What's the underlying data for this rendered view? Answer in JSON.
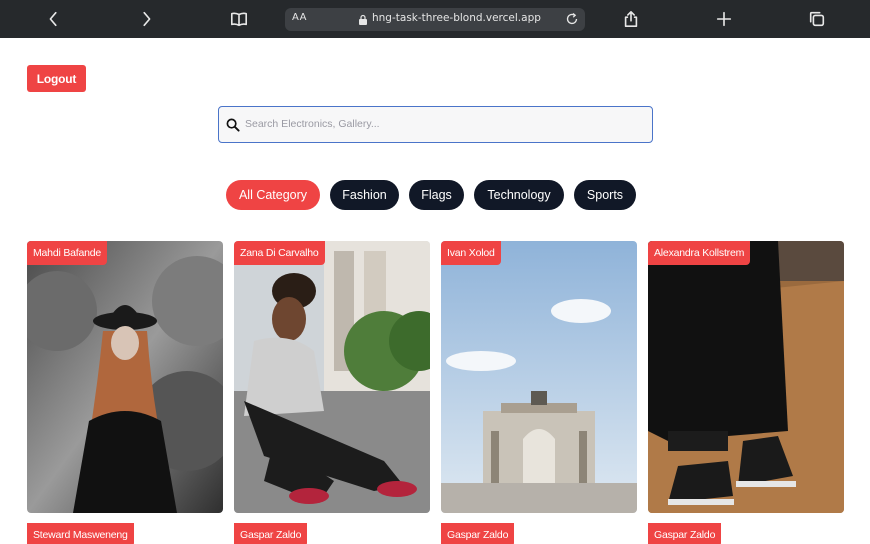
{
  "browser": {
    "aa_label": "AA",
    "url": "hng-task-three-blond.vercel.app"
  },
  "header": {
    "logout_label": "Logout"
  },
  "search": {
    "placeholder": "Search Electronics, Gallery..."
  },
  "categories": [
    {
      "label": "All Category",
      "active": true
    },
    {
      "label": "Fashion",
      "active": false
    },
    {
      "label": "Flags",
      "active": false
    },
    {
      "label": "Technology",
      "active": false
    },
    {
      "label": "Sports",
      "active": false
    }
  ],
  "gallery": {
    "row1": [
      {
        "author": "Mahdi Bafande",
        "icon": "woman-hat-photo"
      },
      {
        "author": "Zana Di Carvalho",
        "icon": "woman-sitting-photo"
      },
      {
        "author": "Ivan Xolod",
        "icon": "arch-monument-photo"
      },
      {
        "author": "Alexandra Kollstrem",
        "icon": "sneakers-walking-photo"
      }
    ],
    "row2": [
      {
        "author": "Steward Masweneng"
      },
      {
        "author": "Gaspar Zaldo"
      },
      {
        "author": "Gaspar Zaldo"
      },
      {
        "author": "Gaspar Zaldo"
      }
    ]
  },
  "colors": {
    "accent": "#ef4444",
    "chip_dark": "#111827",
    "chrome": "#26292c"
  }
}
